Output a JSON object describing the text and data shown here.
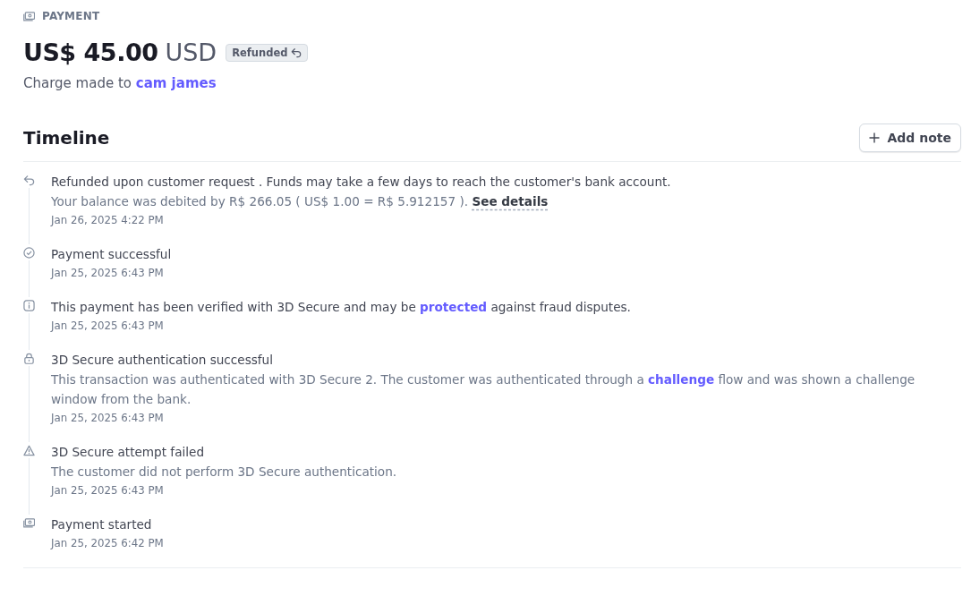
{
  "header": {
    "label": "PAYMENT",
    "amount": "US$ 45.00",
    "currency": "USD",
    "status_badge": "Refunded",
    "charge_prefix": "Charge made to",
    "customer": "cam james"
  },
  "timeline": {
    "title": "Timeline",
    "add_button": "Add note",
    "events": [
      {
        "kind": "refund",
        "title": [
          {
            "text": "Refunded upon customer request . Funds may take a few days to reach the customer's bank account.",
            "kind": "plain"
          }
        ],
        "detail": [
          {
            "text": "Your balance was debited by R$ 266.05 ( US$ 1.00 = R$ 5.912157 ).",
            "kind": "plain"
          },
          {
            "text": "See details",
            "kind": "strong-link"
          }
        ],
        "date": "Jan 26, 2025 4:22 PM"
      },
      {
        "kind": "check",
        "title": [
          {
            "text": "Payment successful",
            "kind": "plain"
          }
        ],
        "date": "Jan 25, 2025 6:43 PM"
      },
      {
        "kind": "info",
        "title": [
          {
            "text": "This payment has been verified with 3D Secure and may be",
            "kind": "plain"
          },
          {
            "text": "protected",
            "kind": "link"
          },
          {
            "text": "against fraud disputes.",
            "kind": "plain"
          }
        ],
        "date": "Jan 25, 2025 6:43 PM"
      },
      {
        "kind": "lock",
        "title": [
          {
            "text": "3D Secure authentication successful",
            "kind": "plain"
          }
        ],
        "detail": [
          {
            "text": "This transaction was authenticated with 3D Secure 2. The customer was authenticated through a",
            "kind": "plain"
          },
          {
            "text": "challenge",
            "kind": "link"
          },
          {
            "text": "flow and was shown a challenge window from the bank.",
            "kind": "plain"
          }
        ],
        "date": "Jan 25, 2025 6:43 PM"
      },
      {
        "kind": "warning",
        "title": [
          {
            "text": "3D Secure attempt failed",
            "kind": "plain"
          }
        ],
        "detail": [
          {
            "text": "The customer did not perform 3D Secure authentication.",
            "kind": "plain"
          }
        ],
        "date": "Jan 25, 2025 6:43 PM"
      },
      {
        "kind": "money",
        "title": [
          {
            "text": "Payment started",
            "kind": "plain"
          }
        ],
        "date": "Jan 25, 2025 6:42 PM"
      }
    ]
  }
}
